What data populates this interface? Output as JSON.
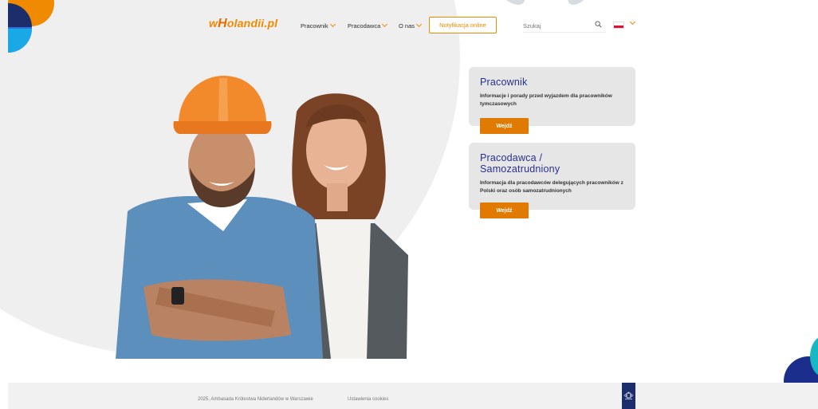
{
  "header": {
    "logo_prefix": "w",
    "logo_big": "H",
    "logo_suffix": "olandii.pl",
    "nav": {
      "item1": "Pracownik",
      "item2": "Pracodawca",
      "item3": "O nas"
    },
    "notify_button": "Notyfikacja online",
    "search_placeholder": "Szukaj",
    "icons": {
      "search": "search-icon",
      "flag": "poland-flag-icon",
      "chevron": "chevron-down-icon"
    }
  },
  "cards": [
    {
      "title": "Pracownik",
      "description": "Informacje i porady przed wyjazdem dla pracowników tymczasowych",
      "button": "Wejdź"
    },
    {
      "title": "Pracodawca / Samozatrudniony",
      "description": "Informacja dla pracodawców delegujących pracowników z Polski oraz osób samozatrudnionych",
      "button": "Wejdź"
    }
  ],
  "footer": {
    "copyright": "2025, Ambasada Królestwa Niderlandów w Warszawie",
    "cookies": "Ustawienia cookies"
  },
  "colors": {
    "accent": "#e07a00",
    "title": "#2a2f8f",
    "card_bg": "#e6e6e6"
  }
}
